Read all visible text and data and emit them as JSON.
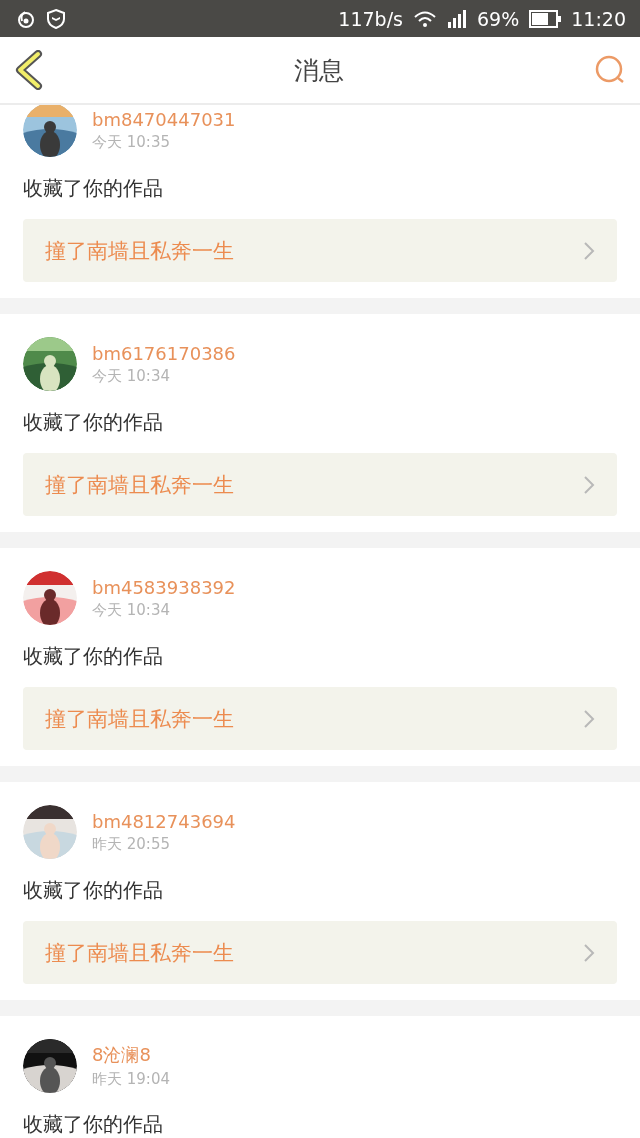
{
  "status_bar": {
    "speed": "117b/s",
    "battery": "69%",
    "time": "11:20"
  },
  "header": {
    "title": "消息"
  },
  "messages": [
    {
      "user": "bm8470447031",
      "time": "今天 10:35",
      "action": "收藏了你的作品",
      "work": "撞了南墙且私奔一生"
    },
    {
      "user": "bm6176170386",
      "time": "今天 10:34",
      "action": "收藏了你的作品",
      "work": "撞了南墙且私奔一生"
    },
    {
      "user": "bm4583938392",
      "time": "今天 10:34",
      "action": "收藏了你的作品",
      "work": "撞了南墙且私奔一生"
    },
    {
      "user": "bm4812743694",
      "time": "昨天 20:55",
      "action": "收藏了你的作品",
      "work": "撞了南墙且私奔一生"
    },
    {
      "user": "8沧澜8",
      "time": "昨天 19:04",
      "action": "收藏了你的作品"
    }
  ]
}
